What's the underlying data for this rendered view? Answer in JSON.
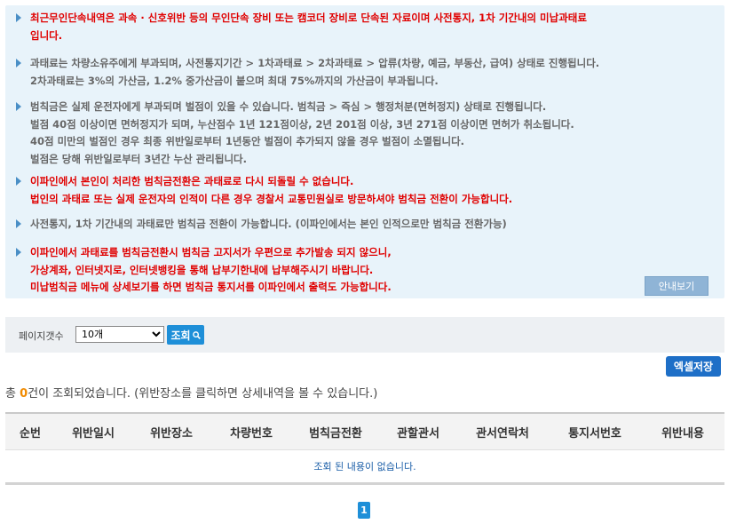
{
  "notice": {
    "items": [
      {
        "style": "red",
        "lines": [
          "최근무인단속내역은 과속 · 신호위반 등의 무인단속 장비 또는 캠코더 장비로 단속된 자료이며 사전통지, 1차 기간내의 미납과태료",
          "입니다."
        ]
      },
      {
        "style": "gray",
        "lines": [
          "과태료는 차량소유주에게 부과되며, 사전통지기간 > 1차과태료 > 2차과태료 > 압류(차량, 예금, 부동산, 급여) 상태로 진행됩니다.",
          "2차과태료는 3%의 가산금, 1.2% 중가산금이 붙으며 최대 75%까지의 가산금이 부과됩니다."
        ]
      },
      {
        "style": "gray",
        "lines": [
          "범칙금은 실제 운전자에게 부과되며 벌점이 있을 수 있습니다. 범칙금 > 즉심 > 행정처분(면허정지) 상태로 진행됩니다.",
          "벌점 40점 이상이면 면허정지가 되며, 누산점수 1년 121점이상, 2년 201점 이상, 3년 271점 이상이면 면허가 취소됩니다.",
          "40점 미만의 벌점인 경우 최종 위반일로부터 1년동안 벌점이 추가되지 않을 경우 벌점이 소멸됩니다.",
          "벌점은 당해 위반일로부터 3년간 누산 관리됩니다."
        ]
      },
      {
        "style": "red",
        "lines": [
          "이파인에서 본인이 처리한 범칙금전환은 과태료로 다시 되돌릴 수 없습니다.",
          "법인의 과태료 또는 실제 운전자의 인적이 다른 경우 경찰서 교통민원실로 방문하셔야 범칙금 전환이 가능합니다."
        ]
      },
      {
        "style": "gray",
        "lines": [
          "사전통지, 1차 기간내의 과태료만 범칙금 전환이 가능합니다. (이파인에서는 본인 인적으로만 범칙금 전환가능)"
        ]
      },
      {
        "style": "red",
        "lines": [
          "이파인에서 과태료를 범칙금전환시 범칙금 고지서가 우편으로 추가발송 되지 않으니,",
          "가상계좌, 인터넷지로, 인터넷뱅킹을 통해 납부기한내에 납부해주시기 바랍니다.",
          "미납범칙금 메뉴에 상세보기를 하면 범칙금 통지서를 이파인에서 출력도 가능합니다."
        ]
      }
    ],
    "guide_button": "안내보기"
  },
  "search": {
    "page_size_label": "페이지갯수",
    "page_size_value": "10개",
    "query_button": "조회"
  },
  "excel_button": "엑셀저장",
  "summary": {
    "prefix": "총 ",
    "count": "0",
    "suffix": "건이 조회되었습니다. (위반장소를 클릭하면 상세내역을 볼 수 있습니다.)"
  },
  "table": {
    "headers": [
      "순번",
      "위반일시",
      "위반장소",
      "차량번호",
      "범칙금전환",
      "관할관서",
      "관서연락처",
      "통지서번호",
      "위반내용"
    ],
    "empty_message": "조회 된 내용이 없습니다."
  },
  "pagination": {
    "current": "1"
  },
  "colors": {
    "accent": "#1e8fd8",
    "notice_red": "#e00000",
    "notice_bg": "#e8f3fa",
    "count_orange": "#f08a00"
  }
}
